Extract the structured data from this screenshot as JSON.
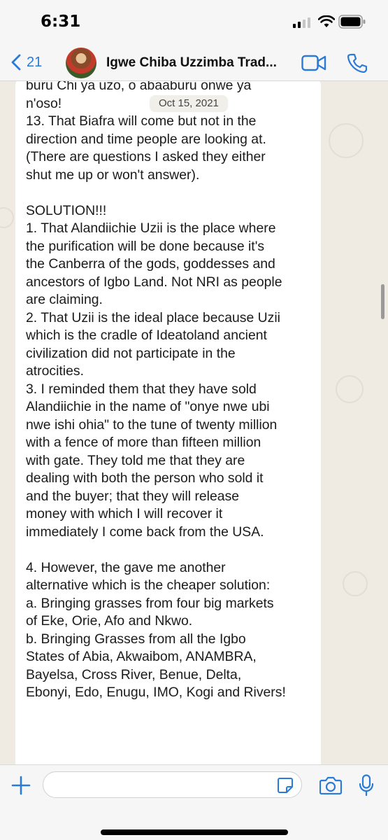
{
  "status_bar": {
    "time": "6:31"
  },
  "header": {
    "back_count": "21",
    "title": "Igwe Chiba Uzzimba Trad..."
  },
  "chat": {
    "date_chip": "Oct 15, 2021",
    "message": "buru Chi ya uzo, o abaaburu onwe ya\nn'oso!\n13. That Biafra will come but not in the\ndirection and time people are looking at.\n(There are questions I asked they either\nshut me up or won't answer).\n\nSOLUTION!!!\n1. That Alandiichie Uzii is the place where\nthe purification will be done because it's\nthe Canberra of the gods, goddesses and\nancestors of Igbo Land. Not NRI as people\nare claiming.\n2. That Uzii is the ideal place because Uzii\nwhich is the cradle of Ideatoland ancient\ncivilization did not participate in the\natrocities.\n3. I reminded them that they have sold\nAlandiichie in the name of \"onye nwe ubi\nnwe ishi ohia\" to the tune of twenty million\nwith a fence of more than fifteen million\nwith gate. They told me that they are\ndealing with both the person who sold it\nand the buyer; that they will release\nmoney with which I will recover it\nimmediately I come back from the USA.\n\n4. However, the gave me another\nalternative which is the cheaper solution:\na. Bringing grasses from four big markets\nof Eke, Orie, Afo and Nkwo.\nb. Bringing Grasses from all the Igbo\nStates of Abia, Akwaibom, ANAMBRA,\nBayelsa, Cross River, Benue, Delta,\nEbonyi, Edo, Enugu, IMO, Kogi and Rivers!"
  },
  "input": {
    "placeholder": ""
  },
  "colors": {
    "accent": "#2a7ad8",
    "bubble": "#ffffff",
    "chat_bg": "#efeae2"
  },
  "icons": {
    "back": "chevron-left-icon",
    "video": "video-camera-icon",
    "call": "phone-icon",
    "plus": "plus-icon",
    "sticker": "sticker-icon",
    "camera": "camera-icon",
    "mic": "microphone-icon",
    "scroll_down": "chevron-down-circle-icon"
  }
}
